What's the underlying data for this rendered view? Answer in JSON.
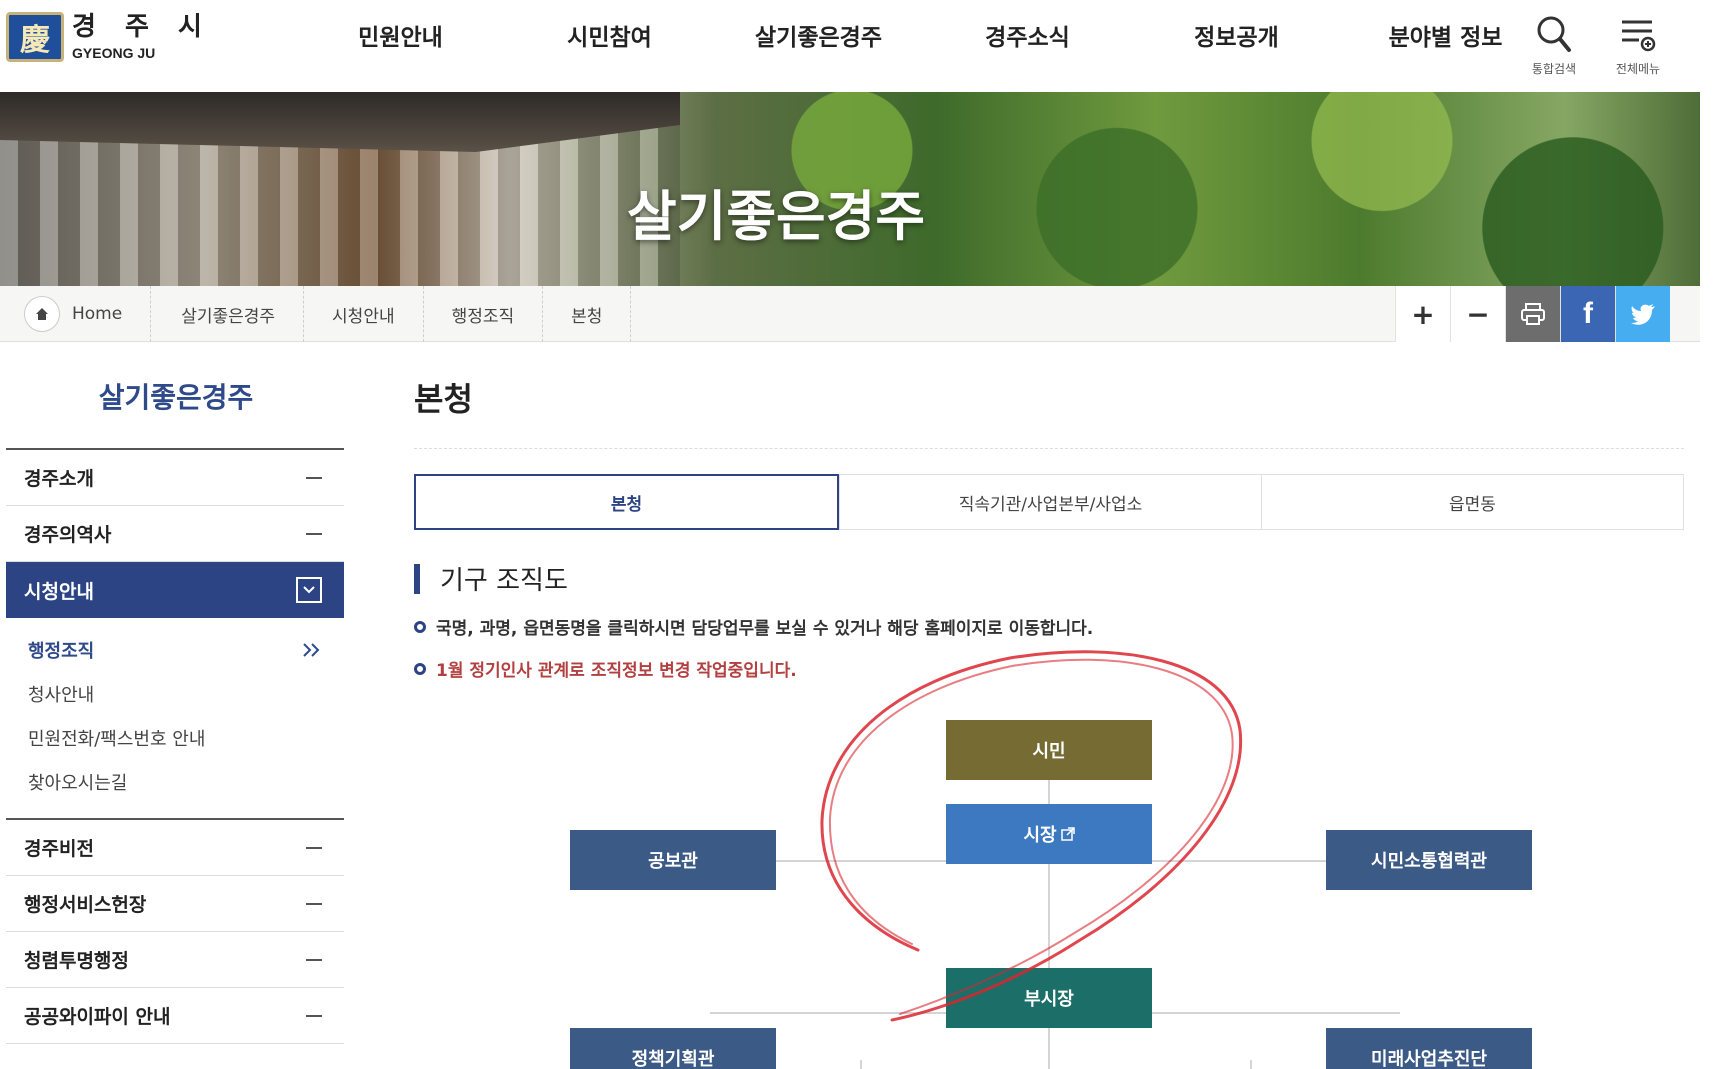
{
  "header": {
    "logo_ko": "경 주 시",
    "logo_en": "GYEONG JU",
    "logo_seal": "慶",
    "nav": [
      "민원안내",
      "시민참여",
      "살기좋은경주",
      "경주소식",
      "정보공개",
      "분야별 정보"
    ],
    "search_label": "통합검색",
    "menu_label": "전체메뉴"
  },
  "banner": {
    "title": "살기좋은경주"
  },
  "breadcrumb": {
    "home": "Home",
    "items": [
      "살기좋은경주",
      "시청안내",
      "행정조직",
      "본청"
    ],
    "tools": {
      "plus": "+",
      "minus": "−",
      "facebook": "f"
    }
  },
  "sidebar": {
    "title": "살기좋은경주",
    "top_items": [
      "경주소개",
      "경주의역사"
    ],
    "active_item": "시청안내",
    "sub_items": [
      "행정조직",
      "청사안내",
      "민원전화/팩스번호 안내",
      "찾아오시는길"
    ],
    "bottom_items": [
      "경주비전",
      "행정서비스헌장",
      "청렴투명행정",
      "공공와이파이 안내"
    ]
  },
  "content": {
    "page_title": "본청",
    "tabs": [
      "본청",
      "직속기관/사업본부/사업소",
      "읍면동"
    ],
    "section_title": "기구 조직도",
    "notes": [
      "국명, 과명, 읍면동명을 클릭하시면 담당업무를 보실 수 있거나 해당 홈페이지로 이동합니다.",
      "1월 정기인사 관계로 조직정보 변경 작업중입니다."
    ]
  },
  "org_chart": {
    "citizen": "시민",
    "mayor": "시장",
    "deputy_mayor": "부시장",
    "left_top": "공보관",
    "right_top": "시민소통협력관",
    "left_bottom": "정책기획관",
    "right_bottom": "미래사업추진단"
  },
  "colors": {
    "primary": "#2c4484",
    "citizen_box": "#756b33",
    "mayor_box": "#3d79c1",
    "deputy_box": "#1c6e68",
    "side_box": "#3b5a85",
    "warn_text": "#b34040",
    "annotation": "#d9262e"
  }
}
